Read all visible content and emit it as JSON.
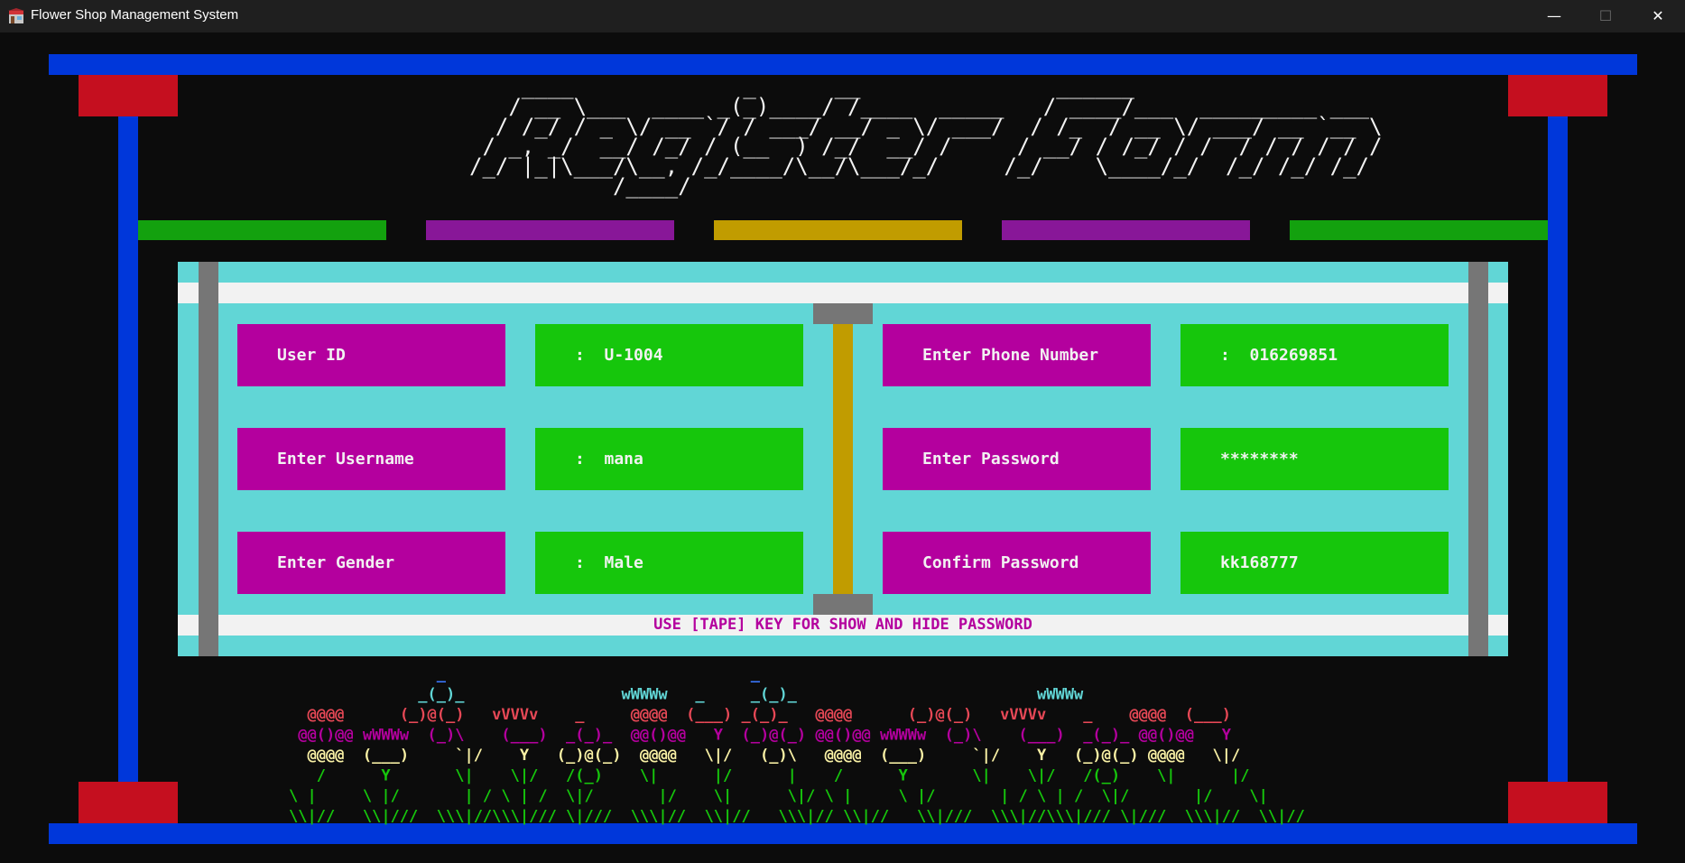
{
  "window": {
    "title": "Flower Shop Management System",
    "icon": "shop-icon",
    "controls": [
      "minimize-icon",
      "maximize-icon",
      "close-icon"
    ]
  },
  "header": {
    "ascii_title": "    ____             _      __               ______\n   / __ \\___  ____ _(_)____/ /____  _____   / ____/___  _________ ___\n  / /_/ / _ \\/ __ `/ / ___/ __/ _ \\/ ___/  / /_  / __ \\/ ___/ __ `__ \\\n / _, _/  __/ /_/ / (__  ) /_/  __/ /     / __/ / /_/ / /  / / / / / /\n/_/ |_|\\___/\\__, /_/____/\\__/\\___/_/     /_/    \\____/_/  /_/ /_/ /_/\n           /____/"
  },
  "form": {
    "fields": [
      {
        "label": "User ID",
        "value": ":  U-1004"
      },
      {
        "label": "Enter Username",
        "value": ":  mana"
      },
      {
        "label": "Enter Gender",
        "value": ":  Male"
      },
      {
        "label": "Enter Phone Number",
        "value": ":  016269851"
      },
      {
        "label": "Enter Password",
        "value": "********"
      },
      {
        "label": "Confirm Password",
        "value": "kk168777"
      }
    ],
    "hint": "USE [TAPE] KEY FOR SHOW AND HIDE PASSWORD"
  },
  "flowers_art": {
    "lines": [
      "                _                                 _",
      "              _(_)_                 wWWWw   _     _(_)_                          wWWWw",
      "  @@@@      (_)@(_)   vVVVv    _     @@@@  (___) _(_)_   @@@@      (_)@(_)   vVVVv    _    @@@@  (___)",
      " @@()@@ wWWWw  (_)\\    (___)  _(_)_  @@()@@   Y  (_)@(_) @@()@@ wWWWw  (_)\\    (___)  _(_)_ @@()@@   Y",
      "  @@@@  (___)     `|/    Y   (_)@(_)  @@@@   \\|/   (_)\\   @@@@  (___)     `|/    Y   (_)@(_) @@@@   \\|/",
      "   /      Y       \\|    \\|/   /(_)    \\|      |/      |    /      Y       \\|    \\|/   /(_)    \\|      |/",
      "\\ |     \\ |/       | / \\ | /  \\|/       |/    \\|      \\|/ \\ |     \\ |/       | / \\ | /  \\|/       |/    \\|",
      "\\\\|//   \\\\|///  \\\\\\|//\\\\\\|/// \\|///  \\\\\\|//  \\\\|//   \\\\\\|// \\\\|//   \\\\|///  \\\\\\|//\\\\\\|/// \\|///  \\\\\\|//  \\\\|//"
    ],
    "colors": {
      "roses": "#e74856",
      "purple": "#b4009e",
      "yellow": "#f9f1a5",
      "cyan": "#61d6d6",
      "blue": "#3b78ff",
      "stems": "#16c60c"
    }
  },
  "palette": {
    "frame_blue": "#0037da",
    "frame_red": "#c50f1f",
    "label_bg": "#b4009e",
    "value_bg": "#16c60c",
    "panel_bg": "#61d6d6",
    "divider": "#c19c00"
  }
}
